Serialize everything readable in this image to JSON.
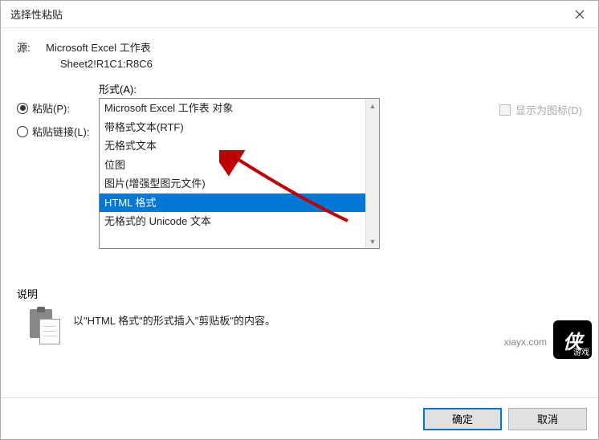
{
  "titlebar": {
    "title": "选择性粘贴"
  },
  "source": {
    "label": "源:",
    "app": "Microsoft Excel 工作表",
    "range": "Sheet2!R1C1:R8C6"
  },
  "radios": {
    "paste": "粘贴(P):",
    "paste_link": "粘贴链接(L):"
  },
  "form_label": "形式(A):",
  "list_items": [
    "Microsoft Excel 工作表 对象",
    "带格式文本(RTF)",
    "无格式文本",
    "位图",
    "图片(增强型图元文件)",
    "HTML 格式",
    "无格式的 Unicode 文本"
  ],
  "selected_index": 5,
  "checkbox": {
    "show_as_icon": "显示为图标(D)"
  },
  "description": {
    "label": "说明",
    "text": "以\"HTML 格式\"的形式插入\"剪贴板\"的内容。"
  },
  "buttons": {
    "ok": "确定",
    "cancel": "取消"
  },
  "watermark": {
    "logo_main": "侠",
    "logo_sub": "游戏",
    "url": "xiayx.com"
  }
}
